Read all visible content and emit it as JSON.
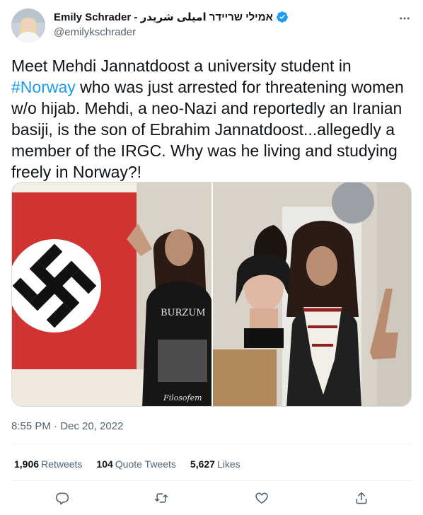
{
  "author": {
    "display_name": "Emily Schrader - אמילי שריידר امیلی شریدر",
    "handle": "@emilykschrader",
    "verified": true
  },
  "tweet": {
    "text_before": "Meet Mehdi Jannatdoost a university student in ",
    "hashtag": "#Norway",
    "text_after": " who was just arrested for threatening women w/o hijab. Mehdi, a neo-Nazi and reportedly an Iranian basiji, is the son of Ebrahim Jannatdoost...allegedly a member of the IRGC. Why was he living and studying freely in Norway?!",
    "photo_shirt_text": "BURZUM",
    "photo_shirt_caption": "Filosofem"
  },
  "timestamp": "8:55 PM · Dec 20, 2022",
  "stats": {
    "retweets_count": "1,906",
    "retweets_label": "Retweets",
    "quotes_count": "104",
    "quotes_label": "Quote Tweets",
    "likes_count": "5,627",
    "likes_label": "Likes"
  },
  "icons": {
    "more": "more-horizontal-icon",
    "verified": "verified-badge-icon",
    "reply": "reply-icon",
    "retweet": "retweet-icon",
    "like": "heart-icon",
    "share": "share-icon"
  },
  "colors": {
    "accent": "#1d9bf0",
    "text": "#0f1419",
    "muted": "#536471",
    "divider": "#eff3f4"
  }
}
